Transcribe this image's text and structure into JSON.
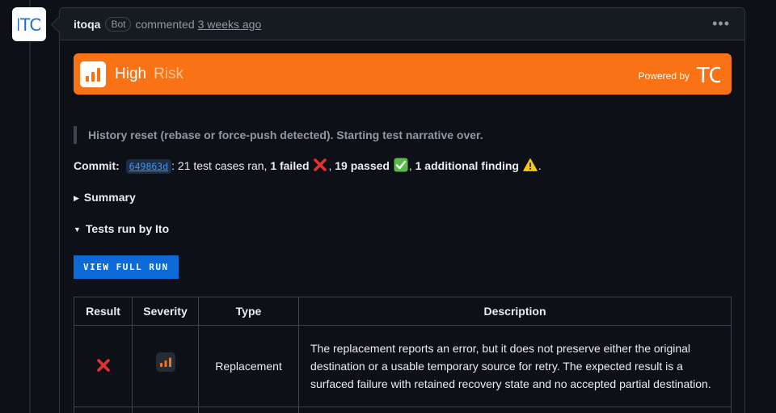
{
  "comment": {
    "author": "itoqa",
    "badge": "Bot",
    "action": "commented",
    "time": "3 weeks ago",
    "menu_icon": "kebab-horizontal-icon"
  },
  "avatar": {
    "logo_text": "ITO"
  },
  "risk_banner": {
    "level": "High",
    "word": "Risk",
    "powered_by": "Powered by",
    "logo_text": "ITO",
    "color": "#f97316"
  },
  "quote": "History reset (rebase or force-push detected). Starting test narrative over.",
  "commit": {
    "label": "Commit:",
    "sha": "649863d",
    "ran": ": 21 test cases ran, ",
    "failed": "1 failed",
    "passed": "19 passed",
    "finding": "1 additional finding",
    "end": "."
  },
  "summary_label": "Summary",
  "tests_label": "Tests run by Ito",
  "view_button": "VIEW FULL RUN",
  "table": {
    "headers": [
      "Result",
      "Severity",
      "Type",
      "Description"
    ],
    "rows": [
      {
        "result": "fail",
        "severity": "high",
        "type": "Replacement",
        "description": "The replacement reports an error, but it does not preserve either the original destination or a usable temporary source for retry. The expected result is a surfaced failure with retained recovery state and no accepted partial destination."
      }
    ]
  }
}
